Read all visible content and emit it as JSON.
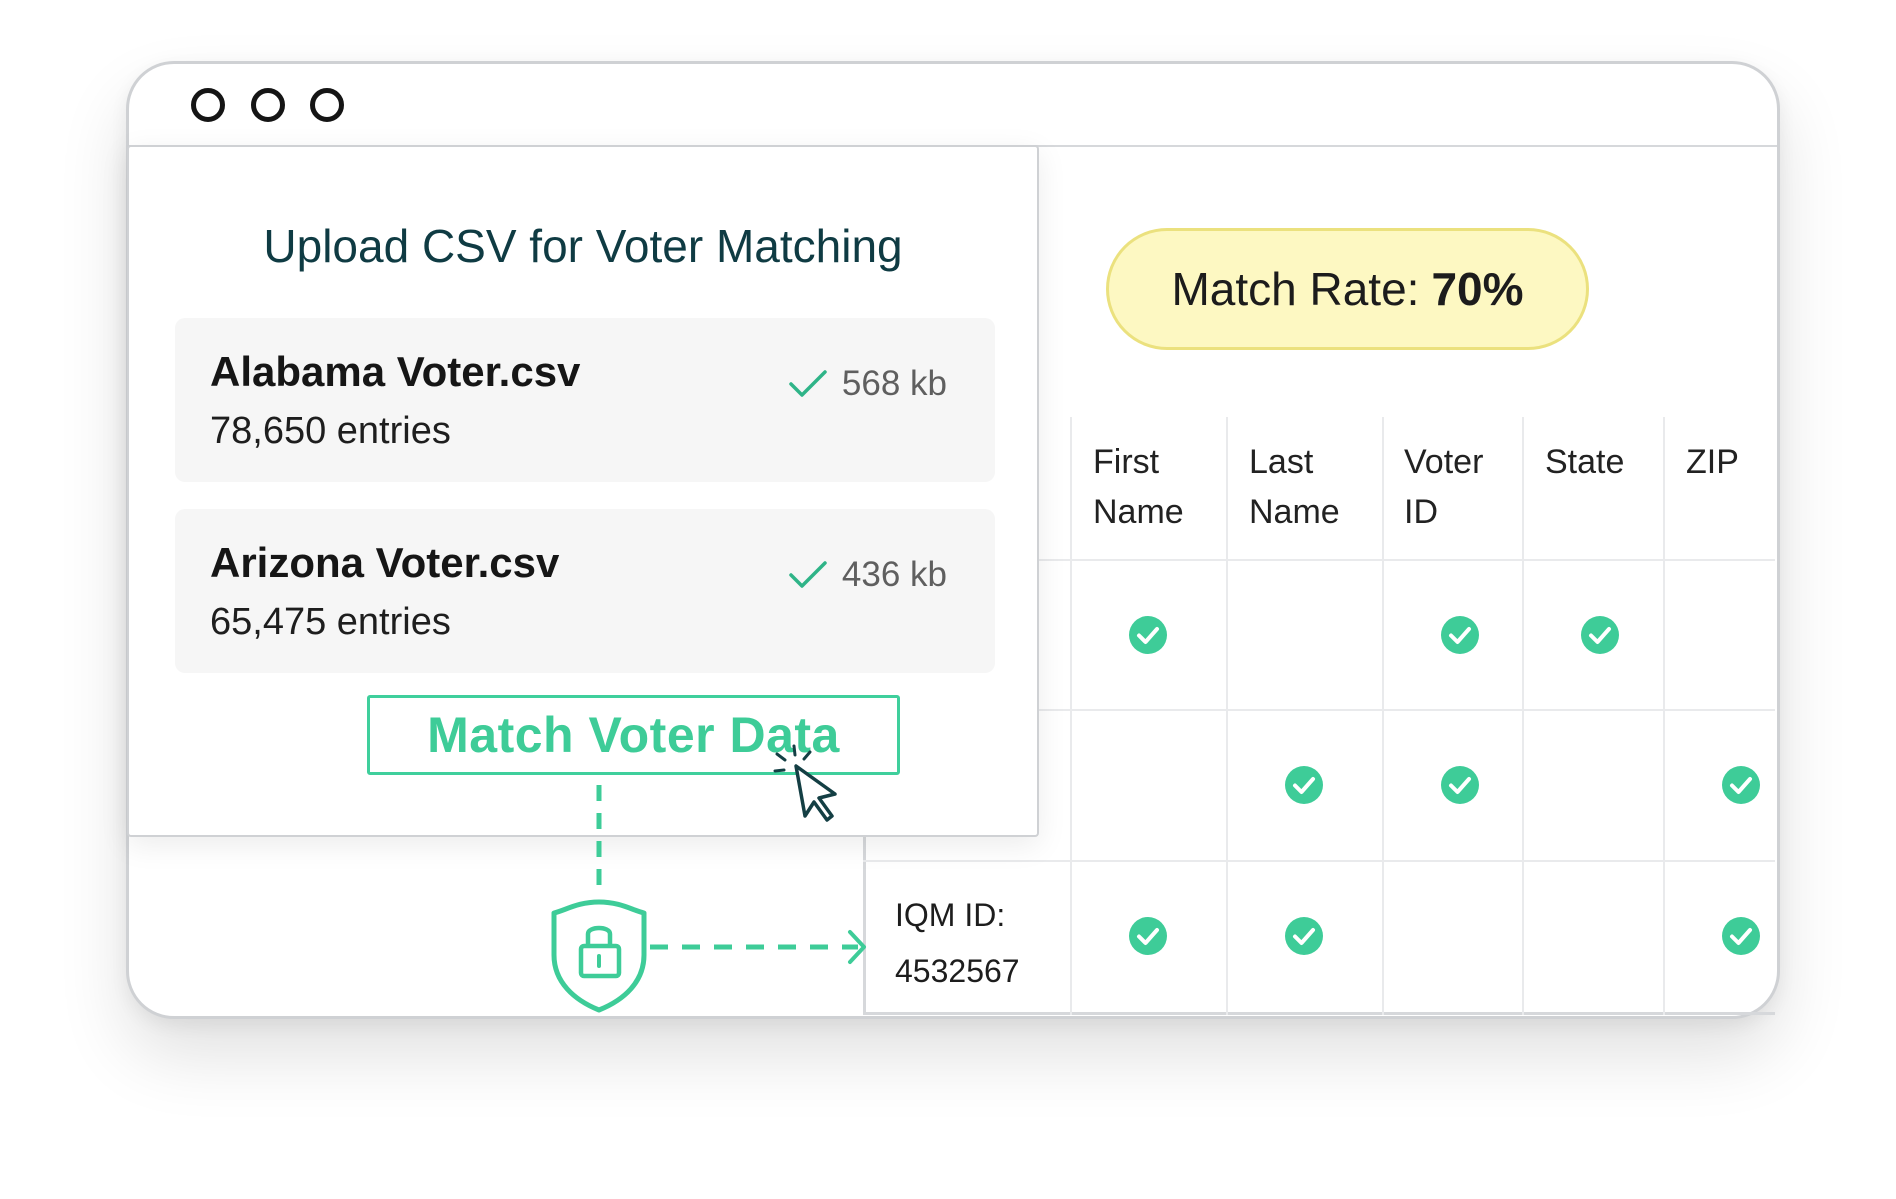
{
  "window": {
    "controls": [
      "window-control-1",
      "window-control-2",
      "window-control-3"
    ]
  },
  "match_rate": {
    "label": "Match Rate:",
    "value": "70%"
  },
  "upload_panel": {
    "title": "Upload CSV for Voter Matching",
    "files": [
      {
        "name": "Alabama Voter.csv",
        "entries": "78,650 entries",
        "size": "568 kb",
        "status": "uploaded"
      },
      {
        "name": "Arizona Voter.csv",
        "entries": "65,475 entries",
        "size": "436 kb",
        "status": "uploaded"
      }
    ],
    "button_label": "Match Voter Data"
  },
  "table": {
    "columns": [
      "First\nName",
      "Last\nName",
      "Voter\nID",
      "State",
      "ZIP"
    ],
    "rows": [
      {
        "label": "",
        "matches": [
          true,
          false,
          true,
          true,
          false
        ]
      },
      {
        "label": "",
        "matches": [
          false,
          true,
          true,
          false,
          true
        ]
      },
      {
        "label": "IQM ID:\n4532567",
        "matches": [
          true,
          true,
          false,
          false,
          true
        ]
      }
    ]
  },
  "icons": {
    "check": "check-icon",
    "matched": "check-circle-icon",
    "secure": "shield-lock-icon",
    "cursor": "cursor-click-icon"
  },
  "colors": {
    "accent": "#3ecc98",
    "title": "#0f3b43",
    "badge_fill": "#fdf8c2",
    "badge_border": "#ebe17e"
  }
}
